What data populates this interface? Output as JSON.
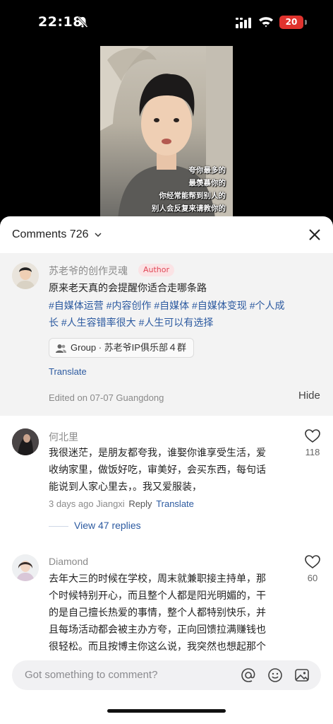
{
  "status_bar": {
    "time": "22:18",
    "battery": "20"
  },
  "video": {
    "caption_lines": [
      "夸你最多的",
      "最羡慕你的",
      "你经常能帮到别人的",
      "别人会反复来请教你的"
    ]
  },
  "sheet": {
    "title": "Comments 726"
  },
  "pinned_comment": {
    "username": "苏老爷的创作灵魂",
    "badge": "Author",
    "text": "原来老天真的会提醒你适合走哪条路",
    "hashtags_line1": "#自媒体运营 #内容创作 #自媒体 #自媒体变现 #个人成",
    "hashtags_line2": "长 #人生容错率很大 #人生可以有选择",
    "group_label": "Group · 苏老爷IP俱乐部４群",
    "translate": "Translate",
    "edited": "Edited on  07-07 Guangdong",
    "hide": "Hide"
  },
  "comments": [
    {
      "username": "何北里",
      "lines": [
        "我很迷茫，是朋友都夸我，谁娶你谁享受生活，爱",
        "收纳家里，做饭好吃，审美好，会买东西，每句话",
        "能说到人家心里去，。我又爱服装，"
      ],
      "meta": "3 days ago Jiangxi",
      "reply": "Reply",
      "translate": "Translate",
      "likes": "118",
      "view_replies": "View 47 replies"
    },
    {
      "username": "Diamond",
      "lines": [
        "去年大三的时候在学校，周末就兼职接主持单，那",
        "个时候特别开心，而且整个人都是阳光明媚的，干",
        "的是自己擅长热爱的事情，整个人都特别快乐，并",
        "且每场活动都会被主办方夸，正向回馈拉满赚钱也",
        "很轻松。而且按博主你这么说，我突然也想起那个"
      ],
      "likes": "60"
    }
  ],
  "input": {
    "placeholder": "Got something to comment?"
  },
  "colors": {
    "link": "#2c5aa0",
    "badge_bg": "#fbe3e5",
    "badge_text": "#e04757",
    "battery": "#e0332e"
  }
}
